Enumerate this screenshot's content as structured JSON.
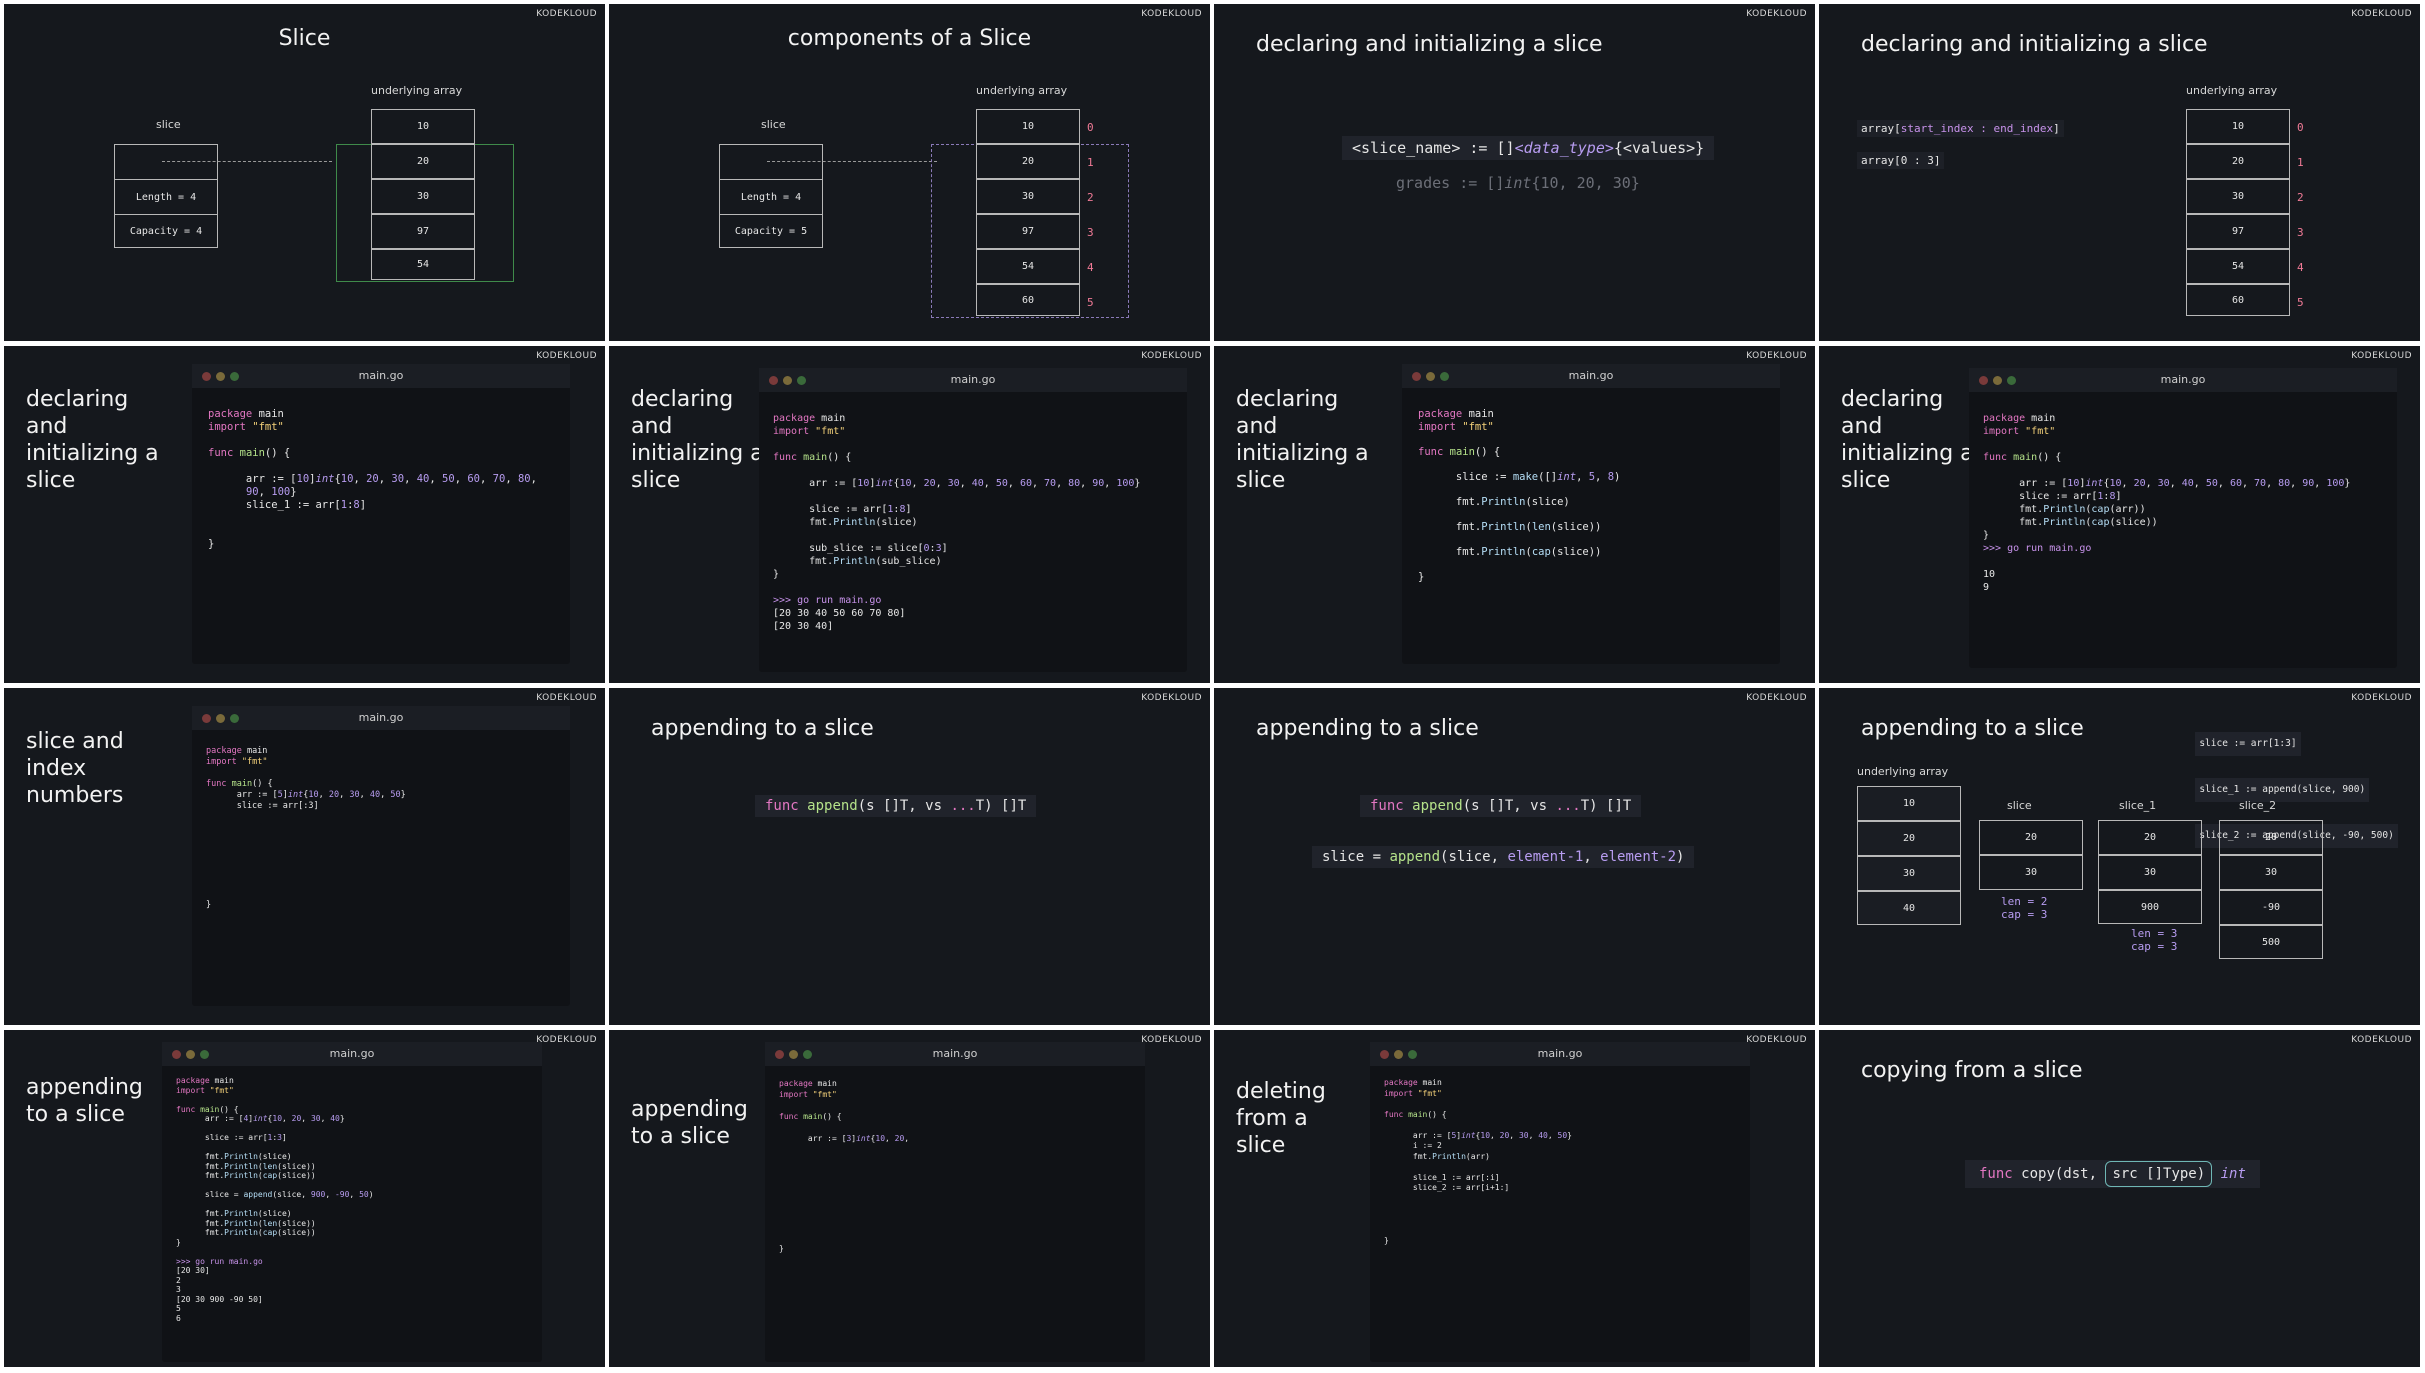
{
  "logo": "KODEKLOUD",
  "s1": {
    "title": "Slice",
    "slice_label": "slice",
    "array_label": "underlying array",
    "length": "Length = 4",
    "capacity": "Capacity = 4",
    "values": [
      "10",
      "20",
      "30",
      "97",
      "54"
    ]
  },
  "s2": {
    "title": "components of a Slice",
    "slice_label": "slice",
    "array_label": "underlying array",
    "length": "Length = 4",
    "capacity": "Capacity = 5",
    "values": [
      "10",
      "20",
      "30",
      "97",
      "54",
      "60"
    ],
    "indices": [
      "0",
      "1",
      "2",
      "3",
      "4",
      "5"
    ]
  },
  "s3": {
    "title": "declaring and initializing a slice",
    "syntax_a": "<slice_name> := []",
    "syntax_type": "<data_type>",
    "syntax_b": "{<values>}",
    "example_a": "grades := []",
    "example_type": "int",
    "example_b": "{10, 20, 30}"
  },
  "s4": {
    "title": "declaring and initializing a slice",
    "line1_a": "array[",
    "line1_b": "start_index : end_index",
    "line1_c": "]",
    "line2": "array[0 : 3]",
    "array_label": "underlying array",
    "values": [
      "10",
      "20",
      "30",
      "97",
      "54",
      "60"
    ],
    "indices": [
      "0",
      "1",
      "2",
      "3",
      "4",
      "5"
    ]
  },
  "s5": {
    "side": "declaring\nand\ninitializing a\nslice",
    "file": "main.go",
    "lines": [
      "package main",
      "import \"fmt\"",
      "",
      "func main() {",
      "",
      "      arr := [10]int{10, 20, 30, 40, 50, 60, 70, 80,",
      "      90, 100}",
      "      slice_1 := arr[1:8]",
      "",
      "",
      "}"
    ]
  },
  "s6": {
    "side": "declaring\nand\ninitializing a\nslice",
    "file": "main.go",
    "lines": [
      "package main",
      "import \"fmt\"",
      "",
      "func main() {",
      "",
      "      arr := [10]int{10, 20, 30, 40, 50, 60, 70, 80, 90, 100}",
      "",
      "      slice := arr[1:8]",
      "      fmt.Println(slice)",
      "",
      "      sub_slice := slice[0:3]",
      "      fmt.Println(sub_slice)",
      "}",
      "",
      ">>> go run main.go",
      "[20 30 40 50 60 70 80]",
      "[20 30 40]"
    ]
  },
  "s7": {
    "side": "declaring\nand\ninitializing a\nslice",
    "file": "main.go",
    "lines": [
      "package main",
      "import \"fmt\"",
      "",
      "func main() {",
      "",
      "      slice := make([]int, 5, 8)",
      "",
      "      fmt.Println(slice)",
      "",
      "      fmt.Println(len(slice))",
      "",
      "      fmt.Println(cap(slice))",
      "",
      "}"
    ]
  },
  "s8": {
    "side": "declaring\nand\ninitializing a\nslice",
    "file": "main.go",
    "lines": [
      "package main",
      "import \"fmt\"",
      "",
      "func main() {",
      "",
      "      arr := [10]int{10, 20, 30, 40, 50, 60, 70, 80, 90, 100}",
      "      slice := arr[1:8]",
      "      fmt.Println(cap(arr))",
      "      fmt.Println(cap(slice))",
      "}",
      ">>> go run main.go",
      "",
      "10",
      "9"
    ]
  },
  "s9": {
    "side": "slice and\nindex\nnumbers",
    "file": "main.go",
    "lines": [
      "package main",
      "import \"fmt\"",
      "",
      "func main() {",
      "      arr := [5]int{10, 20, 30, 40, 50}",
      "      slice := arr[:3]",
      "",
      "",
      "",
      "",
      "",
      "",
      "",
      "",
      "}"
    ]
  },
  "s10": {
    "title": "appending to a slice",
    "sig": "func append(s []T, vs ...T) []T"
  },
  "s11": {
    "title": "appending to a slice",
    "sig": "func append(s []T, vs ...T) []T",
    "call": "slice = append(slice, element-1, element-2)"
  },
  "s12": {
    "title": "appending to a slice",
    "code": [
      "slice := arr[1:3]",
      "slice_1 := append(slice, 900)",
      "slice_2 := append(slice, -90, 500)"
    ],
    "array_label": "underlying array",
    "array": [
      "10",
      "20",
      "30",
      "40"
    ],
    "slice_label": "slice",
    "slice_vals": [
      "20",
      "30"
    ],
    "slice_len": "len = 2",
    "slice_cap": "cap = 3",
    "s1_label": "slice_1",
    "s1_vals": [
      "20",
      "30",
      "900"
    ],
    "s1_len": "len = 3",
    "s1_cap": "cap = 3",
    "s2_label": "slice_2",
    "s2_vals": [
      "20",
      "30",
      "-90",
      "500"
    ]
  },
  "s13": {
    "side": "appending\nto a slice",
    "file": "main.go",
    "lines": [
      "package main",
      "import \"fmt\"",
      "",
      "func main() {",
      "      arr := [4]int{10, 20, 30, 40}",
      "",
      "      slice := arr[1:3]",
      "",
      "      fmt.Println(slice)",
      "      fmt.Println(len(slice))",
      "      fmt.Println(cap(slice))",
      "",
      "      slice = append(slice, 900, -90, 50)",
      "",
      "      fmt.Println(slice)",
      "      fmt.Println(len(slice))",
      "      fmt.Println(cap(slice))",
      "}",
      "",
      ">>> go run main.go",
      "[20 30]",
      "2",
      "3",
      "[20 30 900 -90 50]",
      "5",
      "6"
    ]
  },
  "s14": {
    "side": "appending\nto a slice",
    "file": "main.go",
    "lines": [
      "package main",
      "import \"fmt\"",
      "",
      "func main() {",
      "",
      "      arr := [3]int{10, 20,",
      "",
      "",
      "",
      "",
      "",
      "",
      "",
      "",
      "",
      "}"
    ]
  },
  "s15": {
    "side": "deleting\nfrom a\nslice",
    "file": "main.go",
    "lines": [
      "package main",
      "import \"fmt\"",
      "",
      "func main() {",
      "",
      "      arr := [5]int{10, 20, 30, 40, 50}",
      "      i := 2",
      "      fmt.Println(arr)",
      "",
      "      slice_1 := arr[:i]",
      "      slice_2 := arr[i+1:]",
      "",
      "",
      "",
      "",
      "}"
    ]
  },
  "s16": {
    "title": "copying from a slice",
    "sig_a": "func copy(dst, ",
    "sig_b": "src []Type)",
    "sig_c": " int"
  }
}
